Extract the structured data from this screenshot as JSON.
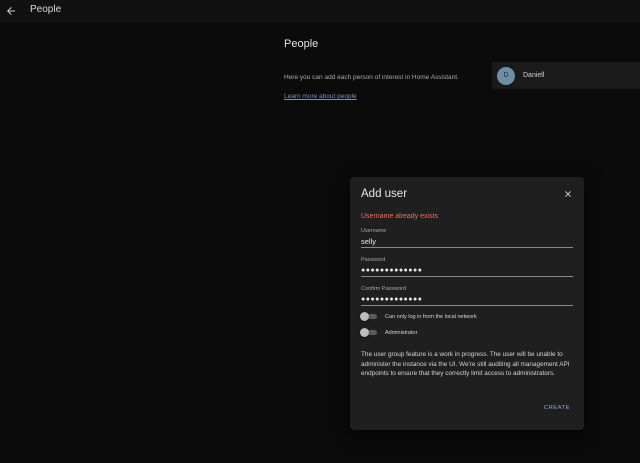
{
  "appbar": {
    "title": "People",
    "back_icon": "arrow-left-icon"
  },
  "page": {
    "heading": "People",
    "intro": "Here you can add each person of interest in Home Assistant.",
    "learn_more": "Learn more about people",
    "persons": [
      {
        "initial": "D",
        "name": "Daniell"
      }
    ]
  },
  "dialog": {
    "title": "Add user",
    "close_icon": "close-icon",
    "error": "Username already exists",
    "username": {
      "label": "Username",
      "value": "selly"
    },
    "password": {
      "label": "Password",
      "value": "●●●●●●●●●●●●●"
    },
    "confirm_password": {
      "label": "Confirm Password",
      "value": "●●●●●●●●●●●●●"
    },
    "toggles": [
      {
        "label": "Can only log in from the local network",
        "on": false
      },
      {
        "label": "Administrator",
        "on": false
      }
    ],
    "info": "The user group feature is a work in progress. The user will be unable to administer the instance via the UI. We're still auditing all management API endpoints to ensure that they correctly limit access to administrators.",
    "create_label": "CREATE"
  },
  "colors": {
    "error": "#e8735c",
    "accent": "#8ea7d6",
    "avatar": "#6e8ea6"
  }
}
